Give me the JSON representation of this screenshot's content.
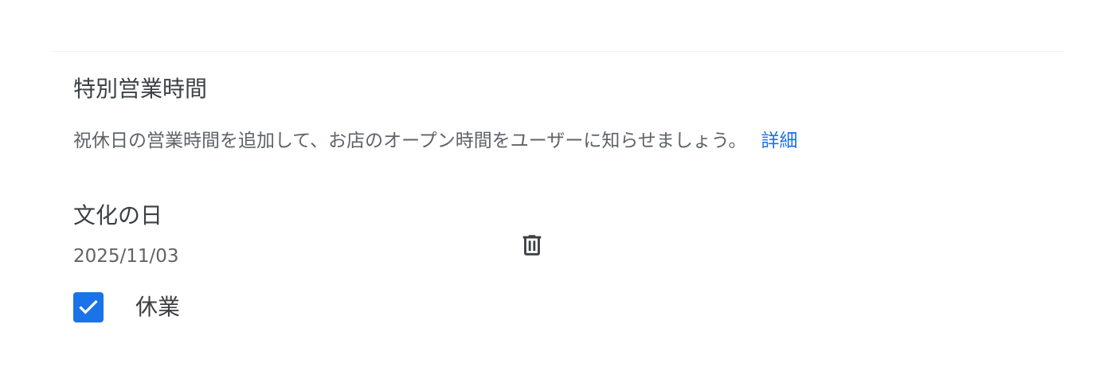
{
  "special_hours": {
    "title": "特別営業時間",
    "description": "祝休日の営業時間を追加して、お店のオープン時間をユーザーに知らせましょう。",
    "learn_more_label": "詳細"
  },
  "holiday": {
    "name": "文化の日",
    "date": "2025/11/03",
    "closed_label": "休業",
    "closed_checked": true,
    "delete_icon": "trash-icon"
  },
  "colors": {
    "accent": "#1a73e8",
    "text_primary": "#3c4043",
    "text_secondary": "#5f6368"
  }
}
